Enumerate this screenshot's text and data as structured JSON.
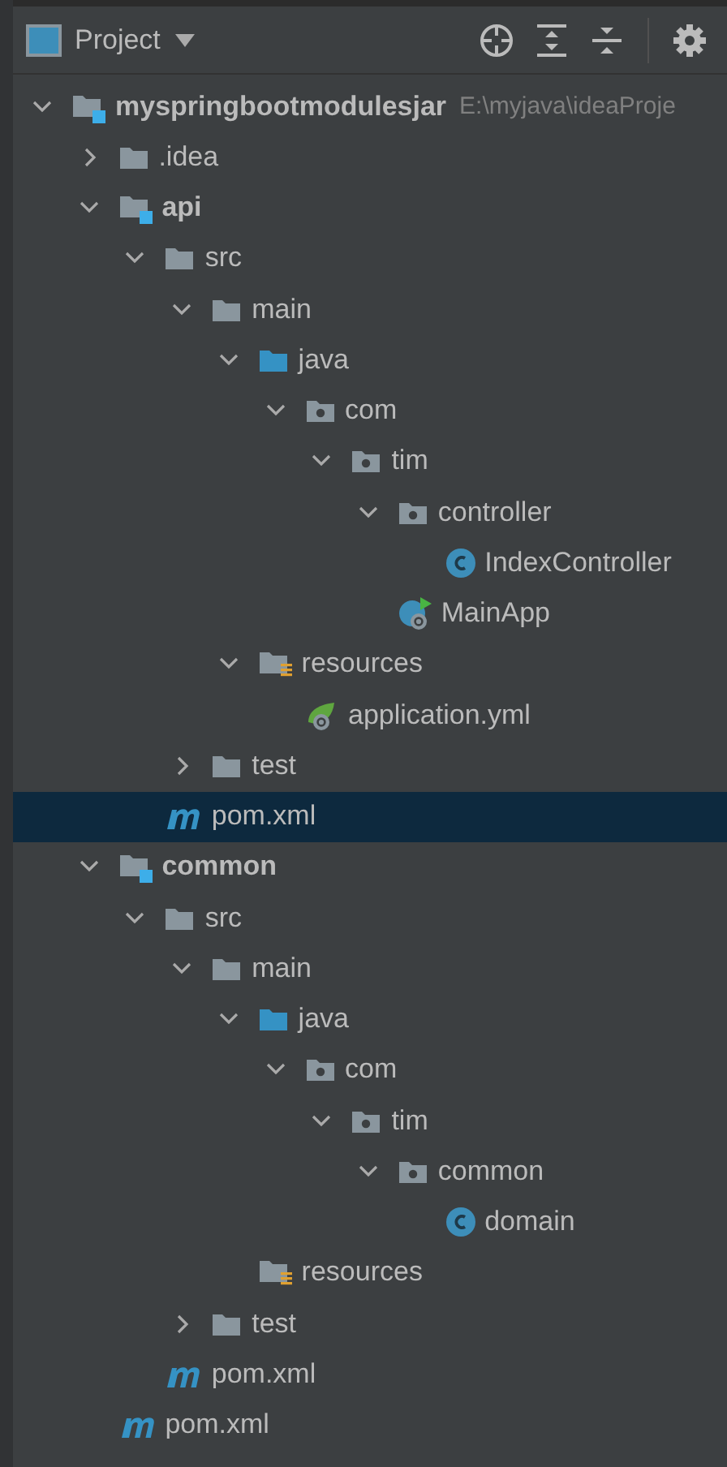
{
  "header": {
    "title": "Project"
  },
  "tree": [
    {
      "label": "myspringbootmodulesjar",
      "hint": "E:\\myjava\\ideaProje",
      "kind": "module",
      "expanded": true,
      "selected": false,
      "children": [
        {
          "label": ".idea",
          "kind": "folder",
          "expanded": false,
          "selected": false
        },
        {
          "label": "api",
          "kind": "module",
          "expanded": true,
          "selected": false,
          "children": [
            {
              "label": "src",
              "kind": "folder",
              "expanded": true,
              "selected": false,
              "children": [
                {
                  "label": "main",
                  "kind": "folder",
                  "expanded": true,
                  "selected": false,
                  "children": [
                    {
                      "label": "java",
                      "kind": "source",
                      "expanded": true,
                      "selected": false,
                      "children": [
                        {
                          "label": "com",
                          "kind": "package",
                          "expanded": true,
                          "selected": false,
                          "children": [
                            {
                              "label": "tim",
                              "kind": "package",
                              "expanded": true,
                              "selected": false,
                              "children": [
                                {
                                  "label": "controller",
                                  "kind": "package",
                                  "expanded": true,
                                  "selected": false,
                                  "children": [
                                    {
                                      "label": "IndexController",
                                      "kind": "class",
                                      "selected": false
                                    }
                                  ]
                                },
                                {
                                  "label": "MainApp",
                                  "kind": "spring-class",
                                  "selected": false
                                }
                              ]
                            }
                          ]
                        }
                      ]
                    },
                    {
                      "label": "resources",
                      "kind": "resources",
                      "expanded": true,
                      "selected": false,
                      "children": [
                        {
                          "label": "application.yml",
                          "kind": "spring-config",
                          "selected": false
                        }
                      ]
                    }
                  ]
                },
                {
                  "label": "test",
                  "kind": "folder",
                  "expanded": false,
                  "selected": false
                }
              ]
            },
            {
              "label": "pom.xml",
              "kind": "maven",
              "selected": true
            }
          ]
        },
        {
          "label": "common",
          "kind": "module",
          "expanded": true,
          "selected": false,
          "children": [
            {
              "label": "src",
              "kind": "folder",
              "expanded": true,
              "selected": false,
              "children": [
                {
                  "label": "main",
                  "kind": "folder",
                  "expanded": true,
                  "selected": false,
                  "children": [
                    {
                      "label": "java",
                      "kind": "source",
                      "expanded": true,
                      "selected": false,
                      "children": [
                        {
                          "label": "com",
                          "kind": "package",
                          "expanded": true,
                          "selected": false,
                          "children": [
                            {
                              "label": "tim",
                              "kind": "package",
                              "expanded": true,
                              "selected": false,
                              "children": [
                                {
                                  "label": "common",
                                  "kind": "package",
                                  "expanded": true,
                                  "selected": false,
                                  "children": [
                                    {
                                      "label": "domain",
                                      "kind": "class",
                                      "selected": false
                                    }
                                  ]
                                }
                              ]
                            }
                          ]
                        }
                      ]
                    },
                    {
                      "label": "resources",
                      "kind": "resources",
                      "selected": false
                    }
                  ]
                },
                {
                  "label": "test",
                  "kind": "folder",
                  "expanded": false,
                  "selected": false
                }
              ]
            },
            {
              "label": "pom.xml",
              "kind": "maven",
              "selected": false
            }
          ]
        },
        {
          "label": "pom.xml",
          "kind": "maven",
          "selected": false
        }
      ]
    }
  ]
}
